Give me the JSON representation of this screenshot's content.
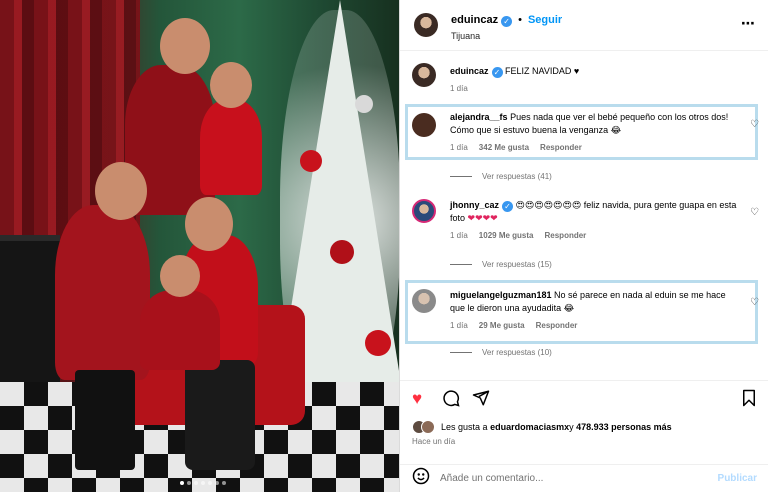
{
  "post": {
    "username": "eduincaz",
    "follow_label": "Seguir",
    "location": "Tijuana",
    "more_icon": "more-horizontal-icon",
    "caption": {
      "username": "eduincaz",
      "text": "FELIZ NAVIDAD ♥",
      "time": "1 día"
    },
    "carousel": {
      "count": 7,
      "active_index": 0
    }
  },
  "comments": [
    {
      "username": "alejandra__fs",
      "text": "Pues nada que ver el bebé pequeño con los otros dos! Cómo que si estuvo buena la venganza",
      "emoji": "😂",
      "time": "1 día",
      "likes": "342 Me gusta",
      "reply_label": "Responder",
      "view_replies": "Ver respuestas (41)",
      "highlighted": true
    },
    {
      "username": "jhonny_caz",
      "emoji_prefix": [
        "😍",
        "😍",
        "😍",
        "😍",
        "😍",
        "😍",
        "😍"
      ],
      "text": "feliz navida, pura gente guapa en esta foto",
      "emoji_suffix": [
        "❤",
        "❤",
        "❤",
        "❤"
      ],
      "time": "1 día",
      "likes": "1029 Me gusta",
      "reply_label": "Responder",
      "view_replies": "Ver respuestas (15)",
      "highlighted": false
    },
    {
      "username": "miguelangelguzman181",
      "text": "No sé parece en nada al eduin se me hace que le dieron una ayudadita",
      "emoji": "😂",
      "time": "1 día",
      "likes": "29 Me gusta",
      "reply_label": "Responder",
      "view_replies": "Ver respuestas (10)",
      "highlighted": true
    }
  ],
  "actions": {
    "like_icon": "heart-filled-icon",
    "comment_icon": "comment-icon",
    "share_icon": "send-icon",
    "save_icon": "bookmark-icon"
  },
  "likes_summary": {
    "prefix": "Les gusta a ",
    "user": "eduardomaciasmx",
    "middle": " y ",
    "count": "478.933 personas más"
  },
  "post_time": "Hace un día",
  "composer": {
    "placeholder": "Añade un comentario...",
    "publish_label": "Publicar",
    "emoji_icon": "smiley-icon"
  },
  "colors": {
    "link_blue": "#0095f6",
    "verified_blue": "#3897f0",
    "like_red": "#ff3040",
    "highlight_border": "#b9dced",
    "publish_disabled": "#b3dbff"
  }
}
